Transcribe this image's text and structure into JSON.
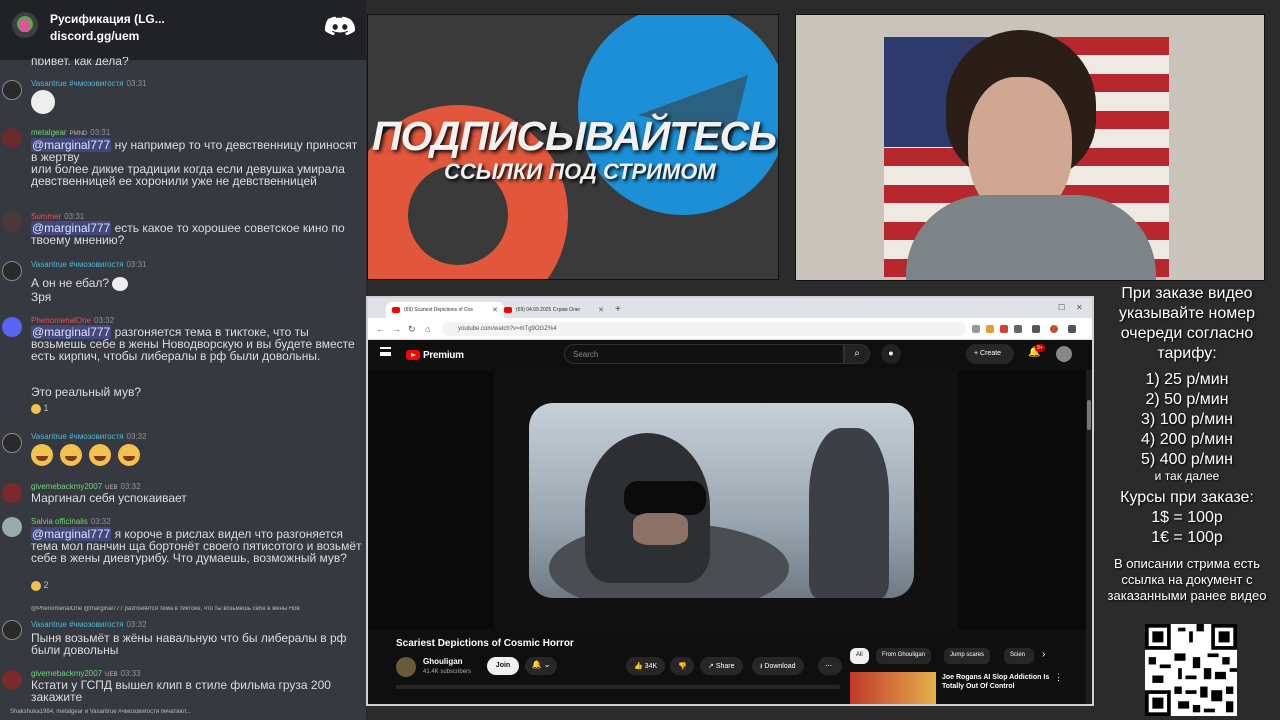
{
  "chat": {
    "header": {
      "server_name": "Русификация (LG...",
      "server_link": "discord.gg/uem"
    },
    "clipped_top_text": "привет, как дела?",
    "messages": [
      {
        "user": "Vasantrue #чмозовигостя",
        "time": "03:31",
        "user_color": "#4fb9d6"
      },
      {
        "user": "metalgear",
        "badge": "PMND",
        "time": "03:31",
        "user_color": "#73d47f",
        "mention": "@marginal777",
        "text": "ну например то что девственницу приносят в жертву\nили более дикие традиции когда если девушка умирала девственницей ее хоронили уже не девственницей"
      },
      {
        "user": "Summer",
        "time": "03:31",
        "user_color": "#e8515b",
        "mention": "@marginal777",
        "text": "есть какое то хорошее советское кино по твоему мнению?"
      },
      {
        "user": "Vasantrue #чмозовигостя",
        "time": "03:31",
        "user_color": "#4fb9d6",
        "text": "А он не ебал?",
        "text2": "Зря"
      },
      {
        "user": "PhenomenalOne",
        "time": "03:32",
        "user_color": "#e8515b",
        "mention": "@marginal777",
        "text": "разгоняется тема в тиктоке, что ты возьмешь себе в жены Новодворскую и вы будете вместе есть кирпич, чтобы либералы в рф были довольны.",
        "text2": "Это реальный мув?",
        "reaction": "1"
      },
      {
        "user": "Vasantrue #чмозовигостя",
        "time": "03:32",
        "user_color": "#4fb9d6"
      },
      {
        "user": "givemebackmy2007",
        "badge": "UEB",
        "time": "03:32",
        "user_color": "#73d47f",
        "text": "Маргинал себя успокаивает"
      },
      {
        "user": "Salvia officinalis",
        "time": "03:32",
        "user_color": "#73d47f",
        "mention": "@marginal777",
        "text": "я короче в рислах видел что разгоняется тема мол панчин ща бортонёт своего пятисотого и возьмёт себе в жены диевтурибу. Что думаешь, возможный мув?",
        "reaction": "2"
      },
      {
        "reply": "@PhenomenalOne @marginal777 разгоняется тема в тиктоке, что ты возьмешь себе в жены Нов",
        "user": "Vasantrue #чмозовигостя",
        "time": "03:32",
        "user_color": "#4fb9d6",
        "text": "Пыня возьмёт в жёны навальную что бы либералы в рф были довольны"
      },
      {
        "user": "givemebackmy2007",
        "badge": "UEB",
        "time": "03:33",
        "user_color": "#73d47f",
        "text": "Кстати у ГСПД вышел клип в стиле фильма груза 200 закажите"
      }
    ],
    "typing": "Shakshuka1984, metalgear и Vasantrue #чмозовигостя печатают..."
  },
  "promo": {
    "title": "ПОДПИСЫВАЙТЕСЬ",
    "subtitle": "ССЫЛКИ ПОД СТРИМОМ"
  },
  "browser": {
    "tabs": [
      {
        "label": "(69) Scariest Depictions of Cos"
      },
      {
        "label": "(69) 04.09.2025 Стрим Олег"
      }
    ],
    "url": "youtube.com/watch?v=mTg9OGZ%4",
    "youtube": {
      "logo": "Premium",
      "search_placeholder": "Search",
      "create_label": "Create",
      "notif_count": "9+",
      "video_title": "Scariest Depictions of Cosmic Horror",
      "channel": "Ghouligan",
      "subscribers": "41.4K subscribers",
      "join_label": "Join",
      "likes": "34K",
      "share_label": "Share",
      "download_label": "Download",
      "chips": [
        "All",
        "From Ghouligan",
        "Jump scares",
        "Scien"
      ],
      "rec_title": "Joe Rogans AI Slop Addiction Is Totally Out Of Control"
    }
  },
  "info": {
    "order_text": "При заказе видео указывайте номер очереди согласно тарифу:",
    "tariffs": [
      "1) 25 р/мин",
      "2) 50 р/мин",
      "3) 100 р/мин",
      "4) 200 р/мин",
      "5) 400 р/мин"
    ],
    "etc": "и так далее",
    "rates_title": "Курсы при заказе:",
    "rates": [
      "1$ = 100р",
      "1€ = 100р"
    ],
    "doc_text": "В описании стрима есть ссылка на документ с заказанными ранее видео"
  }
}
